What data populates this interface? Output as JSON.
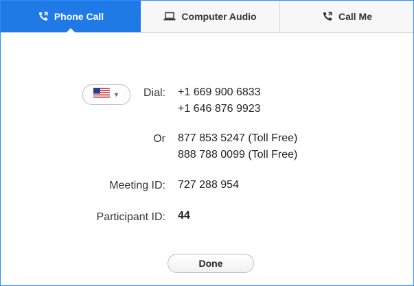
{
  "tabs": [
    {
      "label": "Phone Call",
      "icon": "phone-call-icon"
    },
    {
      "label": "Computer Audio",
      "icon": "laptop-icon"
    },
    {
      "label": "Call Me",
      "icon": "phone-call-icon"
    }
  ],
  "active_tab": "Phone Call",
  "colors": {
    "accent": "#1f7ae6",
    "border": "#2d8cff"
  },
  "country": {
    "flag": "us-flag-icon"
  },
  "dial": {
    "label": "Dial:",
    "numbers": [
      "+1 669 900 6833",
      "+1 646 876 9923"
    ]
  },
  "toll_free": {
    "label": "Or",
    "numbers": [
      "877 853 5247 (Toll Free)",
      "888 788 0099 (Toll Free)"
    ]
  },
  "meeting": {
    "label": "Meeting ID:",
    "value": "727 288 954"
  },
  "participant": {
    "label": "Participant ID:",
    "value": "44"
  },
  "done_label": "Done"
}
